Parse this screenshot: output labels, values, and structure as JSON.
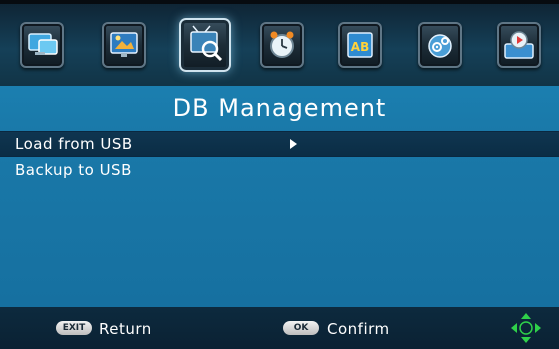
{
  "topbar": {
    "icons": [
      {
        "name": "monitor-icon",
        "active": false
      },
      {
        "name": "picture-icon",
        "active": false
      },
      {
        "name": "channel-search-icon",
        "active": true
      },
      {
        "name": "clock-icon",
        "active": false
      },
      {
        "name": "language-icon",
        "active": false
      },
      {
        "name": "settings-icon",
        "active": false
      },
      {
        "name": "usb-media-icon",
        "active": false
      }
    ],
    "language_icon_text": "AB"
  },
  "title": "DB Management",
  "menu": {
    "items": [
      {
        "label": "Load from USB",
        "selected": true
      },
      {
        "label": "Backup to USB",
        "selected": false
      }
    ]
  },
  "footer": {
    "exit_key": "EXIT",
    "exit_label": "Return",
    "ok_key": "OK",
    "ok_label": "Confirm"
  },
  "colors": {
    "title_band": "#1b7fb0",
    "selected_row": "#0f3550",
    "footer": "#0b2436",
    "dpad_accent": "#2fd14a"
  }
}
